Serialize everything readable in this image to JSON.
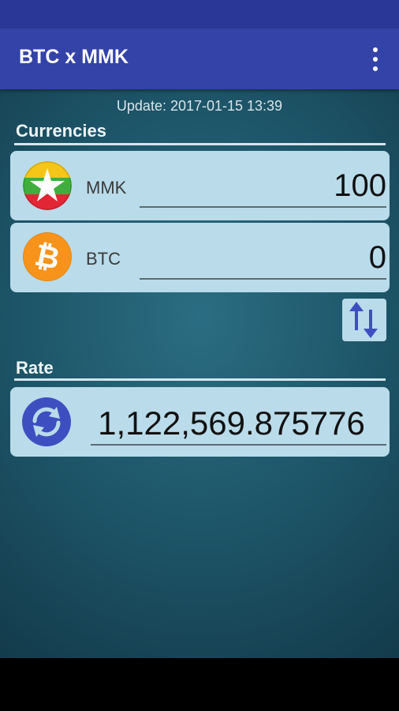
{
  "app": {
    "title": "BTC x MMK"
  },
  "update": {
    "text": "Update: 2017-01-15 13:39"
  },
  "sections": {
    "currencies": "Currencies",
    "rate": "Rate"
  },
  "currencies": [
    {
      "code": "MMK",
      "value": "100",
      "icon": "myanmar-flag-icon"
    },
    {
      "code": "BTC",
      "value": "0",
      "icon": "bitcoin-icon"
    }
  ],
  "rate": {
    "value": "1,122,569.875776",
    "icon": "refresh-icon"
  },
  "colors": {
    "appbar": "#3443a8",
    "statusbar": "#2a3796",
    "card": "#b9dbea",
    "accent_blue": "#3d4fc0",
    "bitcoin_orange": "#f7931a"
  }
}
